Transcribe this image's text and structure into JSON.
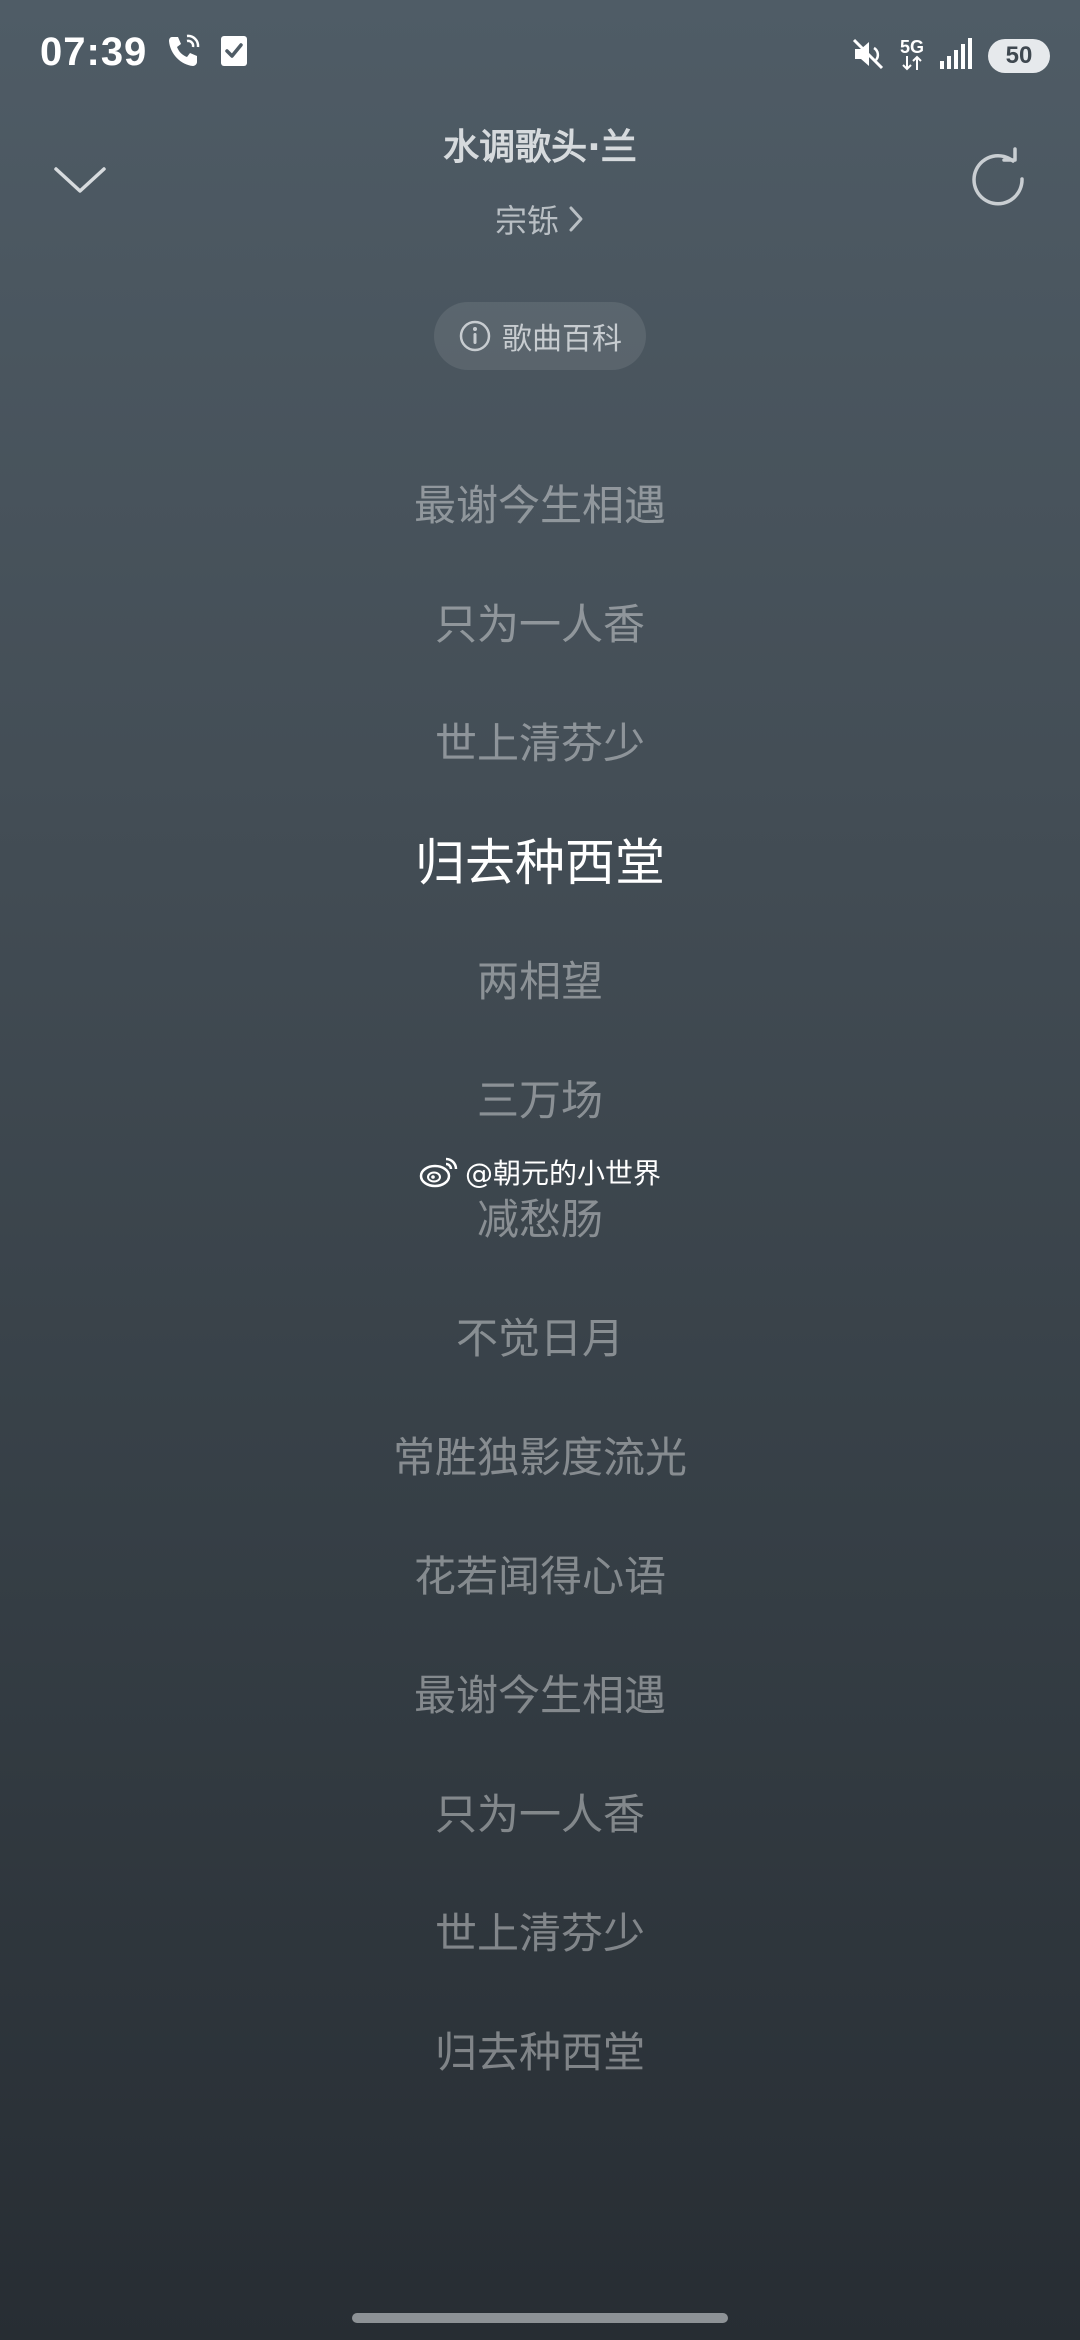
{
  "status_bar": {
    "time": "07:39",
    "network": "5G",
    "battery": "50"
  },
  "header": {
    "song_title": "水调歌头·兰",
    "artist": "宗铄",
    "wiki_label": "歌曲百科"
  },
  "lyrics": [
    "最谢今生相遇",
    "只为一人香",
    "世上清芬少",
    "归去种西堂",
    "两相望",
    "三万场",
    "减愁肠",
    "不觉日月",
    "常胜独影度流光",
    "花若闻得心语",
    "最谢今生相遇",
    "只为一人香",
    "世上清芬少",
    "归去种西堂"
  ],
  "current_lyric_index": 3,
  "watermark": "@朝元的小世界",
  "icons": {
    "call": "phone-wifi-icon",
    "notification": "checkbox-notification-icon",
    "mute": "mute-icon",
    "signal": "signal-bars-icon",
    "collapse": "chevron-down-icon",
    "refresh": "refresh-icon",
    "info": "info-icon",
    "weibo": "weibo-icon",
    "chevron": "chevron-right-icon"
  }
}
